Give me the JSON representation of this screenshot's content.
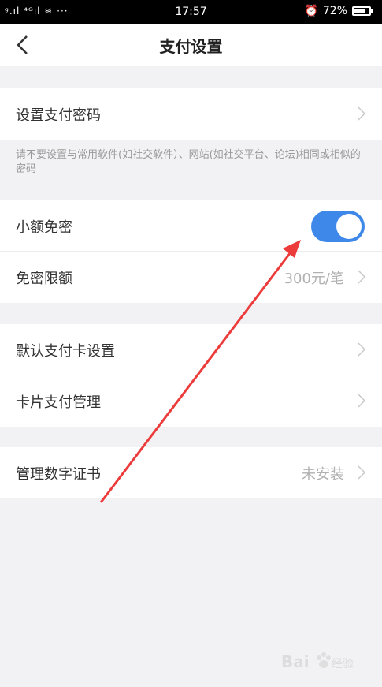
{
  "status_bar": {
    "signal": "ᵍ.ıl ⁴ᴳıl ≋ ···",
    "time": "17:57",
    "alarm": "♫",
    "battery_pct": "72%",
    "battery_level": 0.72
  },
  "nav": {
    "title": "支付设置",
    "back_icon": "back-chevron-icon"
  },
  "sections": {
    "password": {
      "label": "设置支付密码"
    },
    "hint": "请不要设置与常用软件(如社交软件）、网站(如社交平台、论坛)相同或相似的密码",
    "small_free": {
      "label": "小额免密",
      "toggle_on": true
    },
    "limit": {
      "label": "免密限额",
      "value": "300元/笔"
    },
    "default_card": {
      "label": "默认支付卡设置"
    },
    "card_manage": {
      "label": "卡片支付管理"
    },
    "certificate": {
      "label": "管理数字证书",
      "value": "未安装"
    }
  },
  "colors": {
    "accent": "#3e88e9",
    "annotation_arrow": "#ec3b3b"
  },
  "watermark": "Bai经验"
}
